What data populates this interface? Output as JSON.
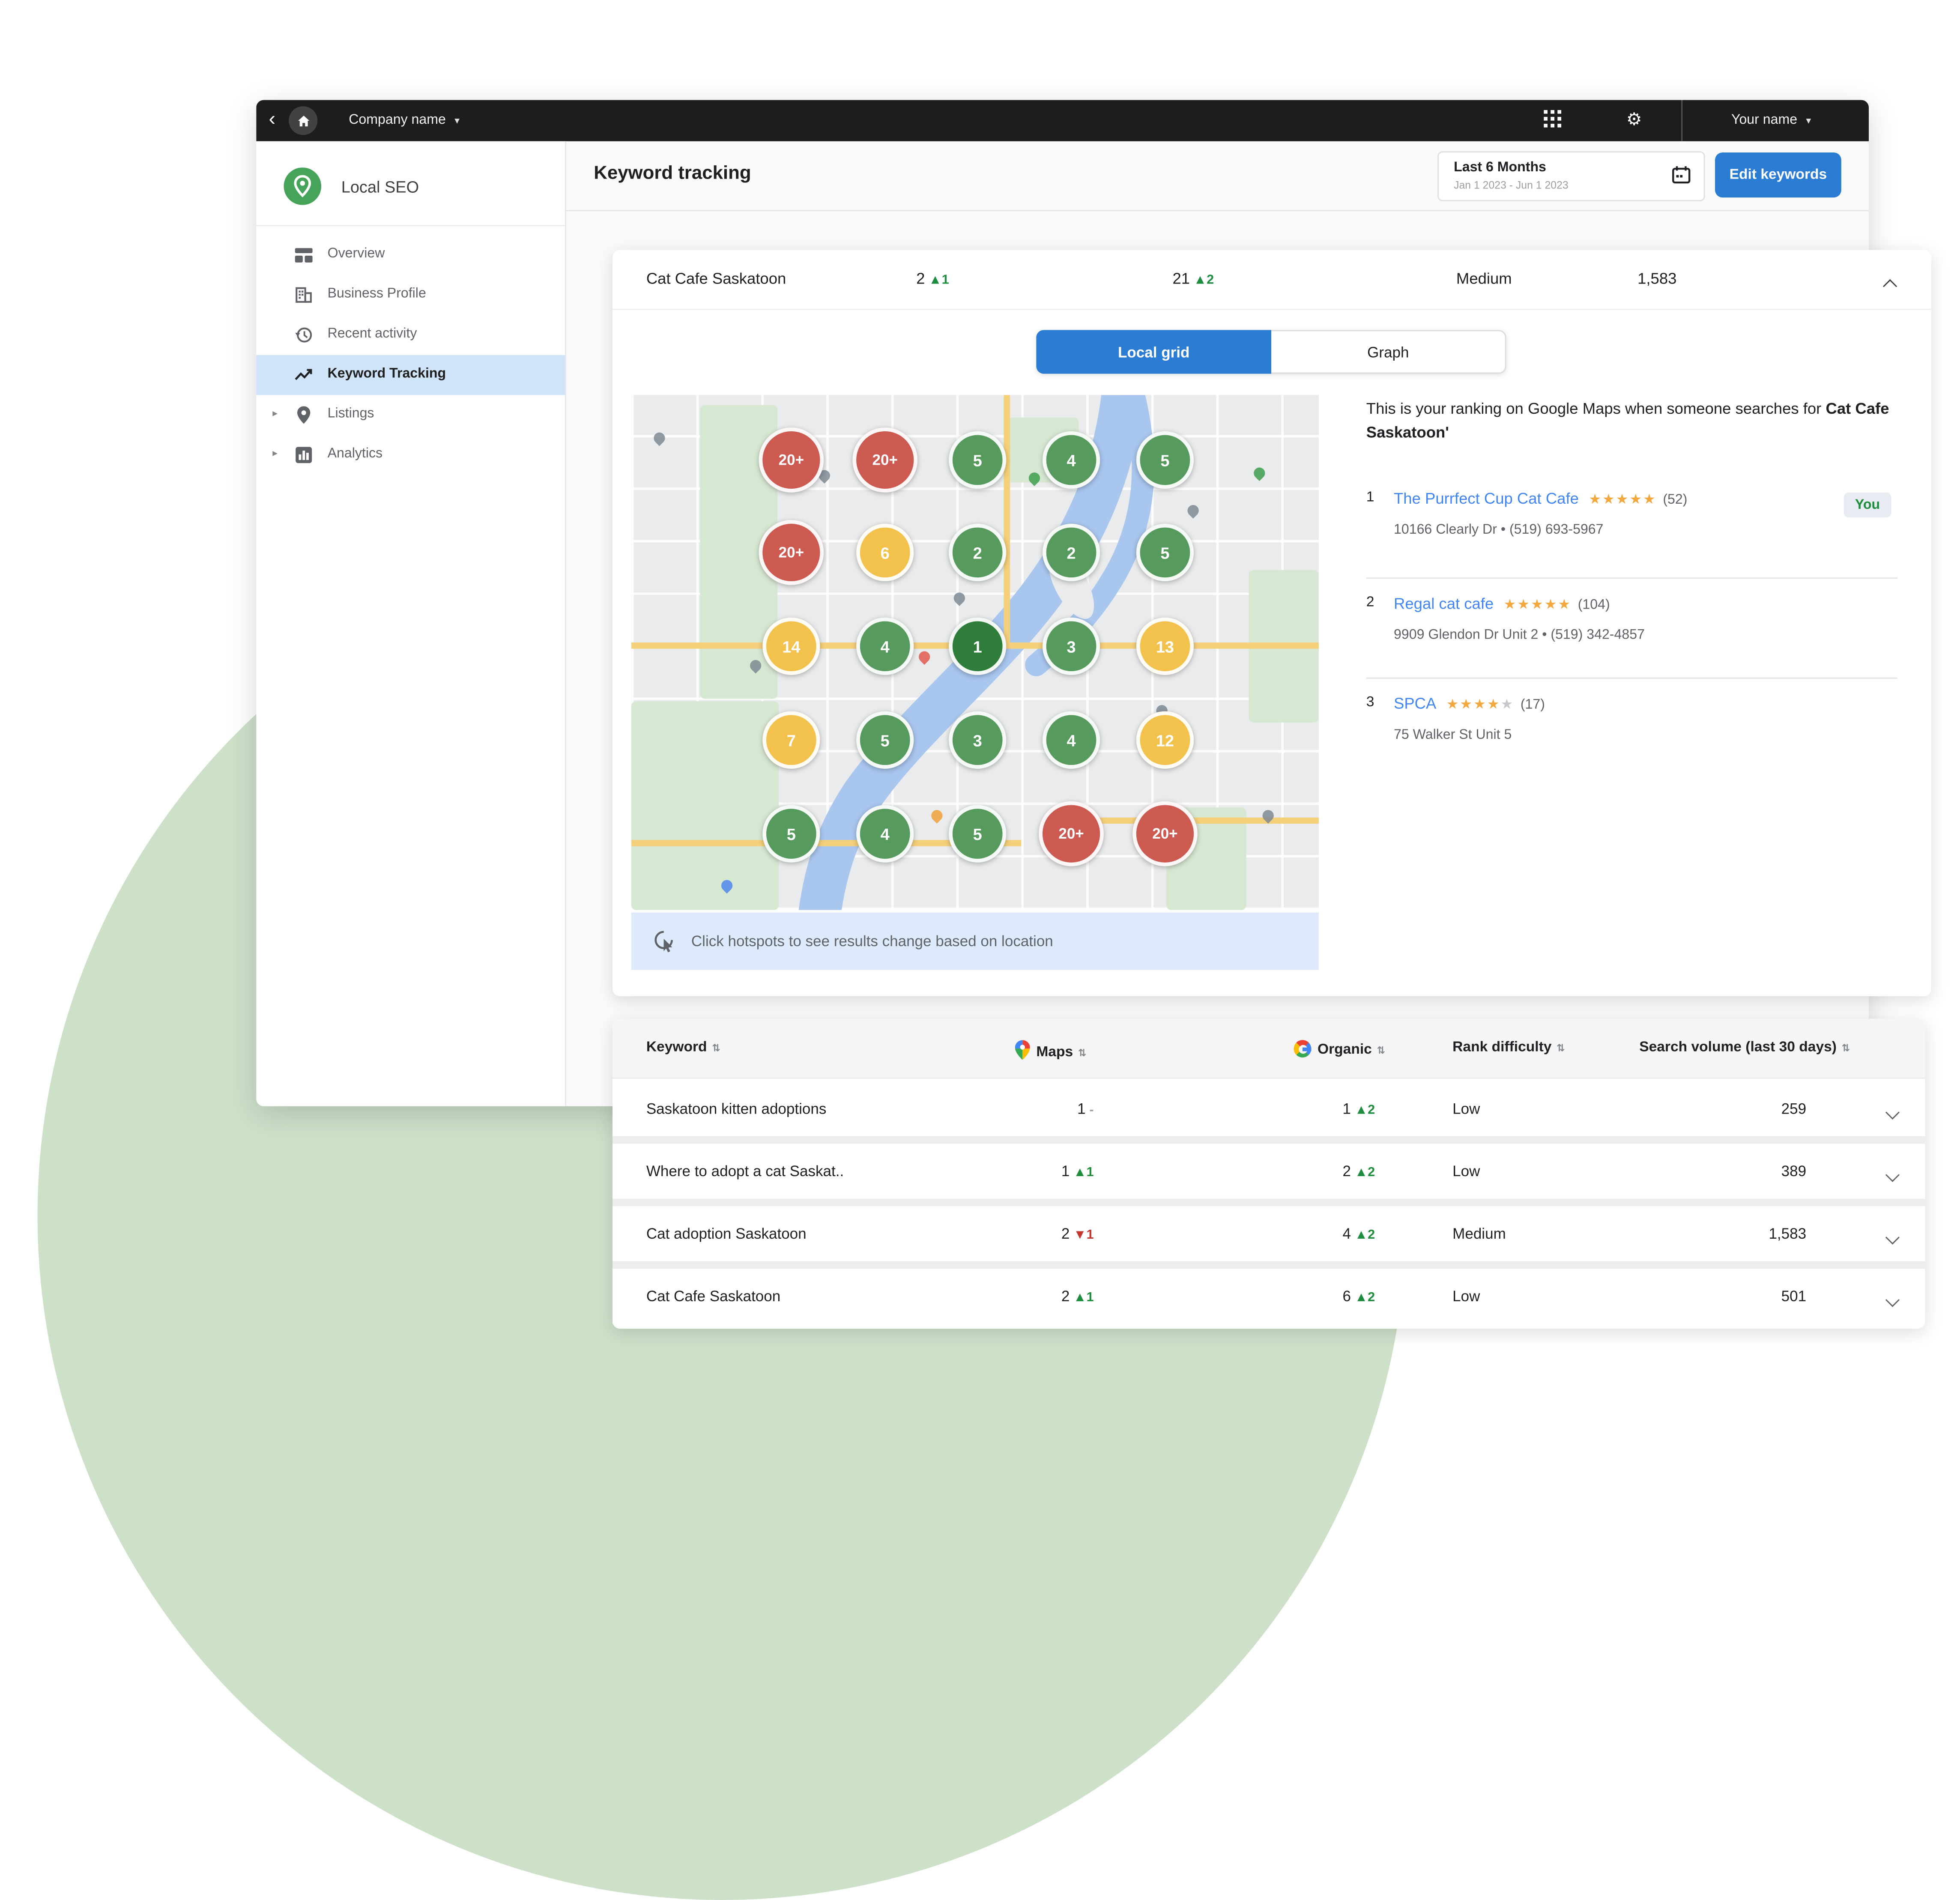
{
  "colors": {
    "accent_blue": "#2b7cd3",
    "top_bar": "#1d1d1d",
    "green_up": "#1e8e3e",
    "red_down": "#c5362c",
    "link_blue": "#4285f4",
    "star_orange": "#f3a73d",
    "grid_green": "#579a5e",
    "grid_dark_green": "#2e7d3a",
    "grid_yellow": "#f2c24c",
    "grid_red": "#cd5a51",
    "active_item_bg": "#cfe4f8",
    "hotspot_bar_bg": "#ddeafb",
    "blob_green": "#cde1c9"
  },
  "topbar": {
    "back_icon": "‹",
    "company_name": "Company name",
    "company_caret": "▾",
    "user_name": "Your name",
    "user_caret": "▾"
  },
  "sidebar": {
    "brand": "Local SEO",
    "expand_caret": "▸",
    "items": [
      {
        "label": "Overview"
      },
      {
        "label": "Business Profile"
      },
      {
        "label": "Recent activity"
      },
      {
        "label": "Keyword Tracking"
      },
      {
        "label": "Listings"
      },
      {
        "label": "Analytics"
      }
    ]
  },
  "header": {
    "title": "Keyword tracking",
    "date_range": "Last 6 Months",
    "date_sub": "Jan 1 2023 - Jun 1 2023",
    "edit_button": "Edit keywords"
  },
  "card": {
    "keyword": "Cat Cafe Saskatoon",
    "maps_rank": "2",
    "maps_arrow": "▲",
    "maps_change": "1",
    "organic_rank": "21",
    "organic_arrow": "▲",
    "organic_change": "2",
    "difficulty": "Medium",
    "volume": "1,583",
    "tabs": [
      {
        "label": "Local grid"
      },
      {
        "label": "Graph"
      }
    ],
    "map_note": "Click hotspots to see results change based on location",
    "intro_text": "This is your ranking on Google Maps when someone searches for",
    "intro_keyword": "Cat Cafe Saskatoon'",
    "grid": [
      {
        "value": "20+",
        "color": "red"
      },
      {
        "value": "20+",
        "color": "red"
      },
      {
        "value": "5",
        "color": "green"
      },
      {
        "value": "4",
        "color": "green"
      },
      {
        "value": "5",
        "color": "green"
      },
      {
        "value": "20+",
        "color": "red"
      },
      {
        "value": "6",
        "color": "yellow"
      },
      {
        "value": "2",
        "color": "green"
      },
      {
        "value": "2",
        "color": "green"
      },
      {
        "value": "5",
        "color": "green"
      },
      {
        "value": "14",
        "color": "yellow"
      },
      {
        "value": "4",
        "color": "green"
      },
      {
        "value": "1",
        "color": "dark-green"
      },
      {
        "value": "3",
        "color": "green"
      },
      {
        "value": "13",
        "color": "yellow"
      },
      {
        "value": "7",
        "color": "yellow"
      },
      {
        "value": "5",
        "color": "green"
      },
      {
        "value": "3",
        "color": "green"
      },
      {
        "value": "4",
        "color": "green"
      },
      {
        "value": "12",
        "color": "yellow"
      },
      {
        "value": "5",
        "color": "green"
      },
      {
        "value": "4",
        "color": "green"
      },
      {
        "value": "5",
        "color": "green"
      },
      {
        "value": "20+",
        "color": "red"
      },
      {
        "value": "20+",
        "color": "red"
      }
    ],
    "listings": [
      {
        "rank": "1",
        "name": "The Purrfect Cup Cat Cafe",
        "stars_filled": "★★★★★",
        "stars_empty": "",
        "reviews": "(52)",
        "address": "10166 Clearly Dr • (519) 693-5967",
        "badge": "You"
      },
      {
        "rank": "2",
        "name": "Regal cat cafe",
        "stars_filled": "★★★★★",
        "stars_empty": "",
        "reviews": "(104)",
        "address": "9909 Glendon Dr Unit 2 • (519) 342-4857"
      },
      {
        "rank": "3",
        "name": "SPCA",
        "stars_filled": "★★★★",
        "stars_empty": "★",
        "reviews": "(17)",
        "address": "75 Walker St Unit 5"
      }
    ]
  },
  "table": {
    "sort_icon": "⇅",
    "columns": {
      "keyword": "Keyword",
      "maps": "Maps",
      "organic": "Organic",
      "difficulty": "Rank difficulty",
      "volume": "Search volume (last 30 days)"
    },
    "rows": [
      {
        "keyword": "Saskatoon kitten adoptions",
        "maps_rank": "1",
        "maps_arrow": "",
        "maps_change": "-",
        "maps_dir": "flat",
        "organic_rank": "1",
        "organic_arrow": "▲",
        "organic_change": "2",
        "organic_dir": "up",
        "difficulty": "Low",
        "volume": "259"
      },
      {
        "keyword": "Where to adopt a cat Saskat..",
        "maps_rank": "1",
        "maps_arrow": "▲",
        "maps_change": "1",
        "maps_dir": "up",
        "organic_rank": "2",
        "organic_arrow": "▲",
        "organic_change": "2",
        "organic_dir": "up",
        "difficulty": "Low",
        "volume": "389"
      },
      {
        "keyword": "Cat adoption Saskatoon",
        "maps_rank": "2",
        "maps_arrow": "▼",
        "maps_change": "1",
        "maps_dir": "down",
        "organic_rank": "4",
        "organic_arrow": "▲",
        "organic_change": "2",
        "organic_dir": "up",
        "difficulty": "Medium",
        "volume": "1,583"
      },
      {
        "keyword": "Cat Cafe Saskatoon",
        "maps_rank": "2",
        "maps_arrow": "▲",
        "maps_change": "1",
        "maps_dir": "up",
        "organic_rank": "6",
        "organic_arrow": "▲",
        "organic_change": "2",
        "organic_dir": "up",
        "difficulty": "Low",
        "volume": "501"
      }
    ]
  }
}
